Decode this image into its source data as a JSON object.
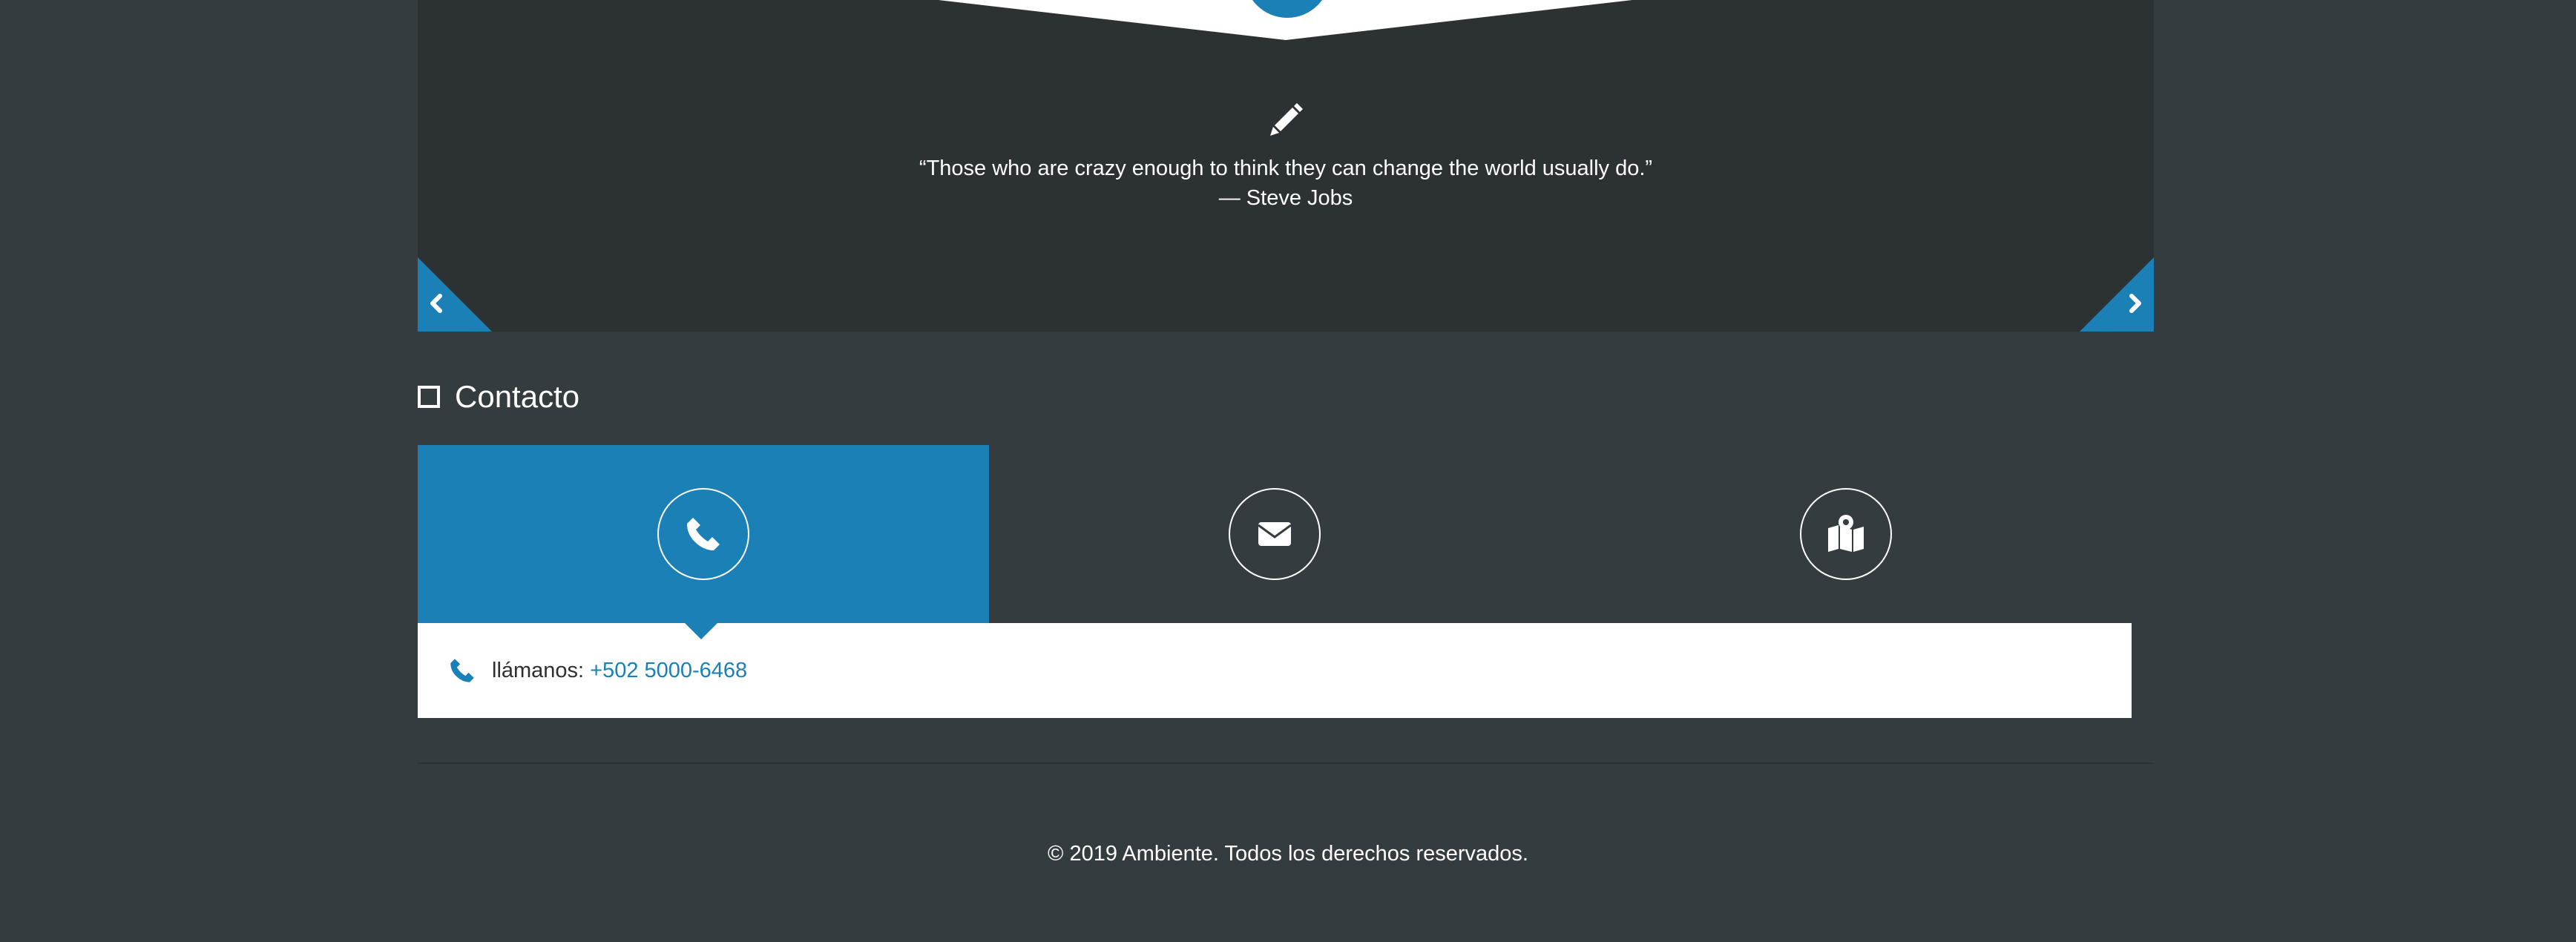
{
  "testimonial": {
    "quote": "“Those who are crazy enough to think they can change the world usually do.”",
    "author": "— Steve Jobs",
    "icon": "pencil-icon",
    "prev_icon": "chevron-left-icon",
    "next_icon": "chevron-right-icon"
  },
  "contact": {
    "title": "Contacto",
    "tabs": [
      {
        "icon": "phone-icon",
        "active": true
      },
      {
        "icon": "envelope-icon",
        "active": false
      },
      {
        "icon": "map-icon",
        "active": false
      }
    ],
    "panel": {
      "label": "llámanos:",
      "phone": "+502 5000-6468"
    }
  },
  "footer": {
    "copyright": "© 2019 Ambiente. Todos los derechos reservados."
  },
  "colors": {
    "accent": "#1a80b6",
    "page_bg": "#353c40",
    "slider_bg": "#2c3134",
    "panel_bg": "#ffffff"
  }
}
